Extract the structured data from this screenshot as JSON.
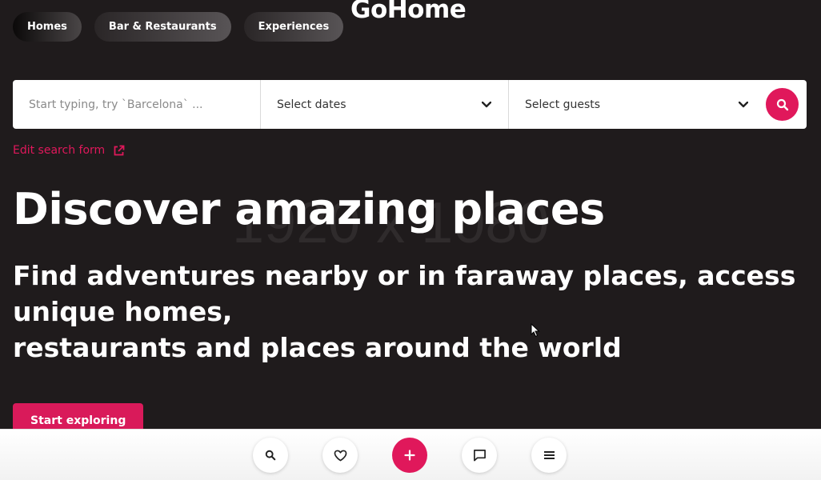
{
  "nav": {
    "categories": [
      {
        "label": "Homes"
      },
      {
        "label": "Bar & Restaurants"
      },
      {
        "label": "Experiences"
      }
    ]
  },
  "brand": {
    "name": "GoHome"
  },
  "search": {
    "location_placeholder": "Start typing, try `Barcelona` ...",
    "dates_label": "Select dates",
    "guests_label": "Select guests"
  },
  "edit_search": {
    "label": "Edit search form"
  },
  "hero": {
    "watermark": "1920 x 1080",
    "title": "Discover amazing places",
    "subtitle_lines": [
      "Find adventures nearby or in faraway places, access",
      "unique homes,",
      "restaurants and places around the world"
    ],
    "cta_label": "Start exploring"
  },
  "bottom_nav": {
    "buttons": [
      {
        "icon": "search-icon"
      },
      {
        "icon": "heart-icon"
      },
      {
        "icon": "plus-icon"
      },
      {
        "icon": "chat-icon"
      },
      {
        "icon": "menu-icon"
      }
    ]
  },
  "colors": {
    "accent": "#e0185b",
    "background": "#1f1b1c"
  }
}
